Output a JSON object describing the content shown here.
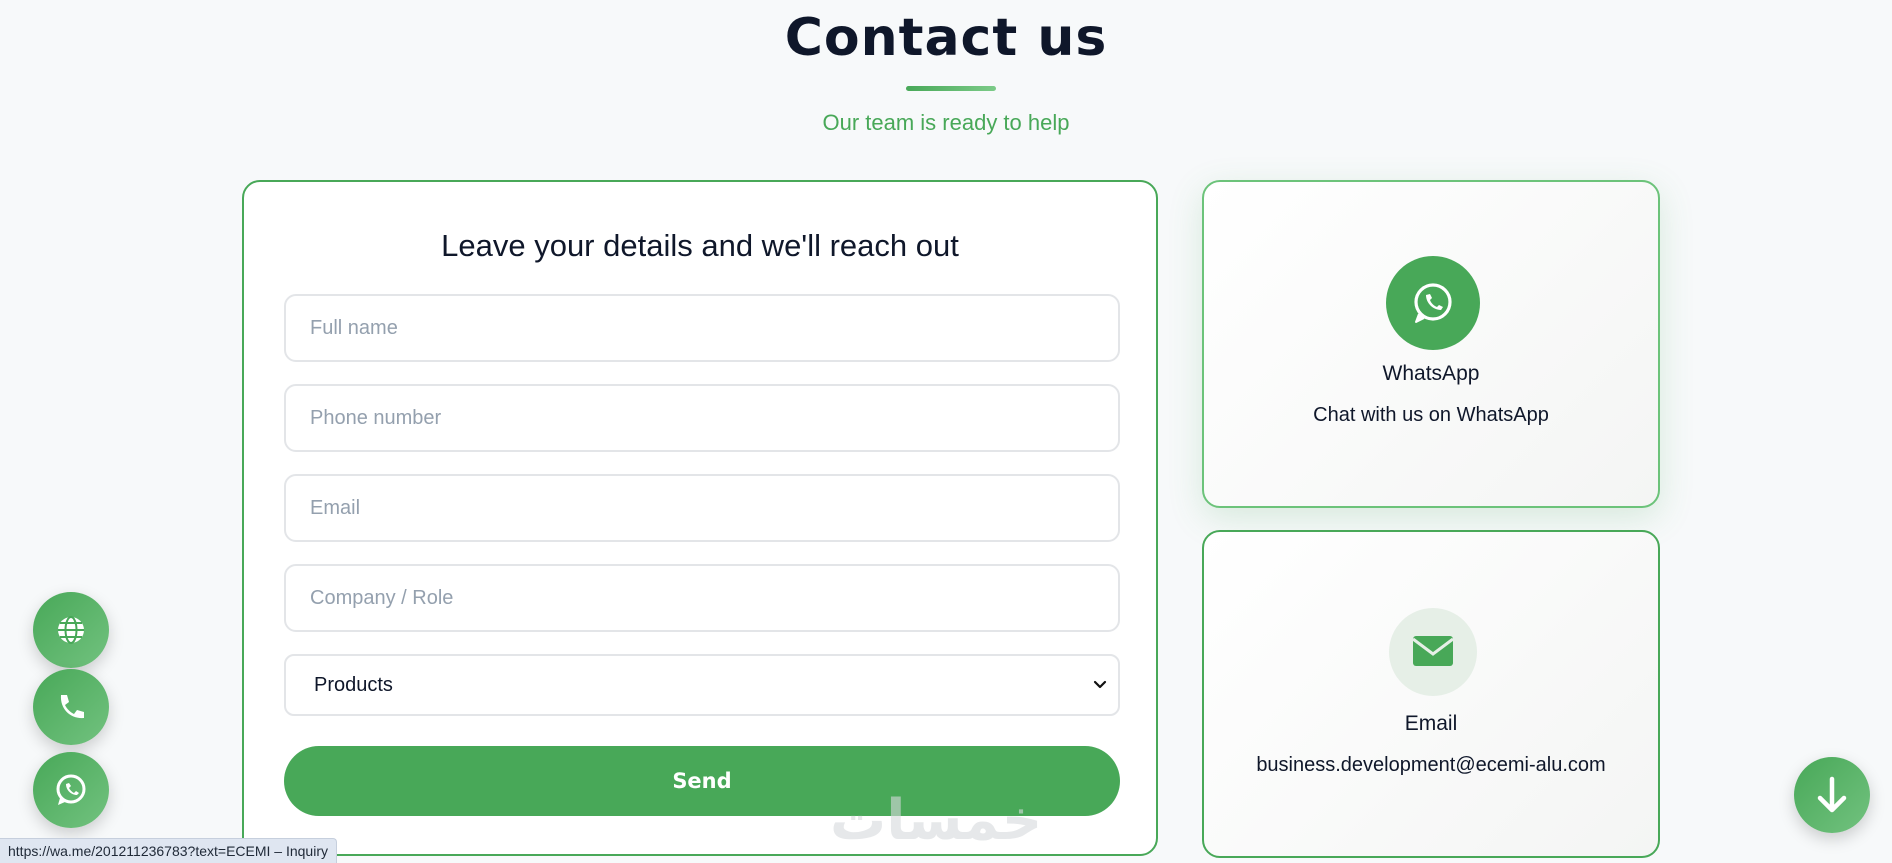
{
  "header": {
    "title": "Contact us",
    "subtitle": "Our team is ready to help"
  },
  "form": {
    "title": "Leave your details and we'll reach out",
    "fields": {
      "full_name": "Full name",
      "phone": "Phone number",
      "email": "Email",
      "company": "Company / Role"
    },
    "select_value": "Products",
    "submit_label": "Send"
  },
  "cards": {
    "whatsapp": {
      "title": "WhatsApp",
      "text": "Chat with us on WhatsApp",
      "icon": "whatsapp-icon"
    },
    "email": {
      "title": "Email",
      "text": "business.development@ecemi-alu.com",
      "icon": "envelope-icon"
    }
  },
  "floating": {
    "buttons": [
      "globe-icon",
      "phone-icon",
      "whatsapp-icon"
    ],
    "scroll": "arrow-down-icon"
  },
  "status_bar": {
    "url": "https://wa.me/201211236783?text=ECEMI – Inquiry"
  },
  "watermark": "خمسات",
  "colors": {
    "accent": "#48a858",
    "text": "#0f172a",
    "background": "#f7f9fa"
  }
}
